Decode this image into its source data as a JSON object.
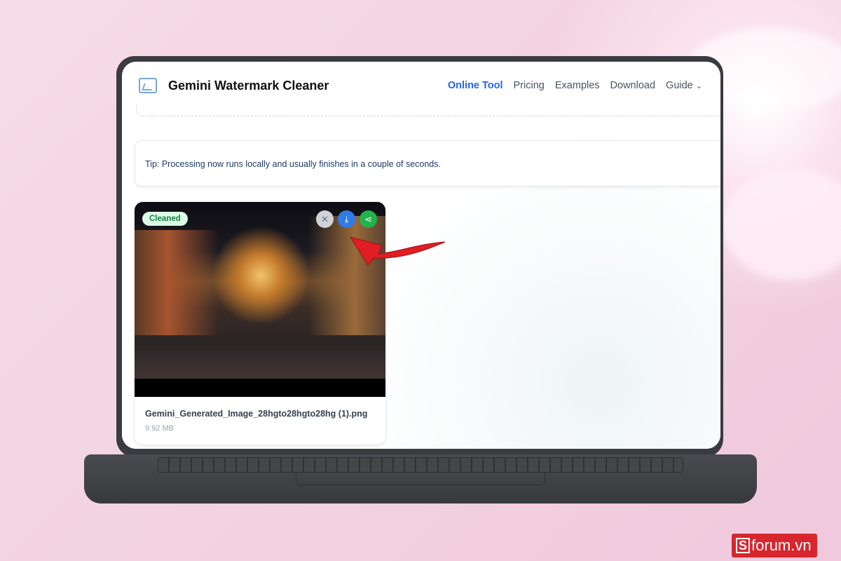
{
  "header": {
    "brand": "Gemini Watermark Cleaner",
    "nav": [
      "Online Tool",
      "Pricing",
      "Examples",
      "Download",
      "Guide"
    ],
    "guide_chevron": "⌄"
  },
  "tip": "Tip: Processing now runs locally and usually finishes in a couple of seconds.",
  "card": {
    "badge": "Cleaned",
    "filename": "Gemini_Generated_Image_28hgto28hgto28hg (1).png",
    "size": "9.92 MB",
    "remove_icon": "✕",
    "download_icon": "⤓",
    "share_icon": "⋖"
  },
  "watermark": {
    "s": "S",
    "text": "forum.vn"
  },
  "colors": {
    "accent": "#2563eb",
    "remove": "#cfd2d6",
    "download": "#2f7be8",
    "share": "#22b34a",
    "arrow": "#e01e24"
  }
}
